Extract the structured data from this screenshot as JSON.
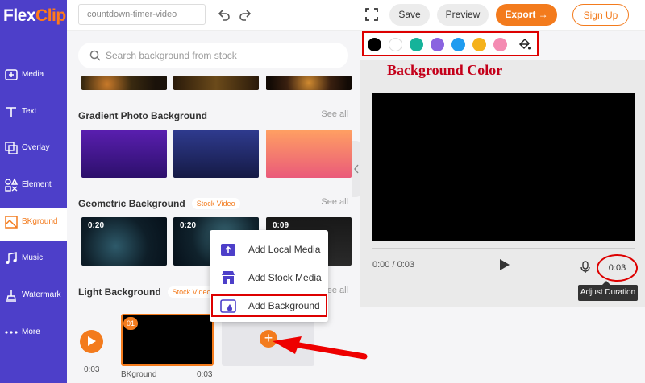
{
  "app": {
    "logo_prefix": "Flex",
    "logo_suffix": "Clip"
  },
  "sidebar": {
    "items": [
      {
        "label": "Media",
        "icon": "media-icon"
      },
      {
        "label": "Text",
        "icon": "text-icon"
      },
      {
        "label": "Overlay",
        "icon": "overlay-icon"
      },
      {
        "label": "Element",
        "icon": "element-icon"
      },
      {
        "label": "BKground",
        "icon": "background-icon",
        "active": true
      },
      {
        "label": "Music",
        "icon": "music-icon"
      },
      {
        "label": "Watermark",
        "icon": "watermark-icon"
      },
      {
        "label": "More",
        "icon": "more-icon"
      }
    ]
  },
  "topbar": {
    "project_name": "countdown-timer-video",
    "save_label": "Save",
    "preview_label": "Preview",
    "export_label": "Export →",
    "signup_label": "Sign Up"
  },
  "panel": {
    "search_placeholder": "Search background from stock",
    "sections": [
      {
        "title": "Gradient Photo Background",
        "see_all": "See all"
      },
      {
        "title": "Geometric Background",
        "tag": "Stock Video",
        "see_all": "See all",
        "durations": [
          "0:20",
          "0:20",
          "0:09"
        ]
      },
      {
        "title": "Light Background",
        "tag": "Stock Video",
        "see_all": "See all"
      }
    ]
  },
  "colors": {
    "swatches": [
      "#000000",
      "#ffffff",
      "#15b39a",
      "#8a63e0",
      "#1f9cf0",
      "#f5b21b",
      "#f48bb2"
    ],
    "accent": "#f37b1d",
    "annotation_color": "#c4001a"
  },
  "annotation": {
    "background_color_title": "Background Color"
  },
  "preview": {
    "time_position": "0:00 / 0:03",
    "duration": "0:03",
    "tooltip": "Adjust Duration"
  },
  "menu": {
    "items": [
      "Add Local Media",
      "Add Stock Media",
      "Add Background"
    ]
  },
  "timeline": {
    "play_time": "0:03",
    "clip_number": "01",
    "clip_name": "BKground",
    "clip_duration": "0:03",
    "add_symbol": "+"
  }
}
